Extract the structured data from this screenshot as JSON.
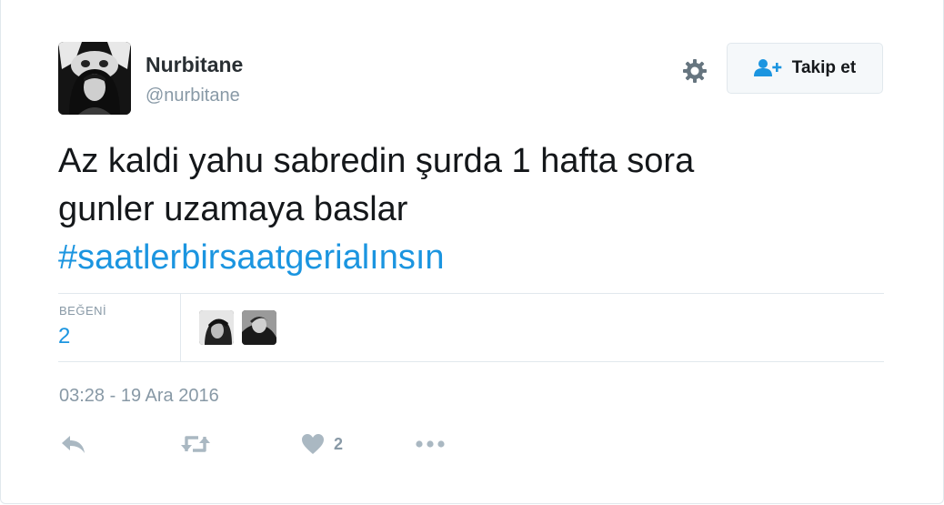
{
  "user": {
    "display_name": "Nurbitane",
    "handle": "@nurbitane"
  },
  "follow_button": {
    "label": "Takip et"
  },
  "tweet": {
    "text_line1": "Az kaldi yahu sabredin şurda 1 hafta sora",
    "text_line2": "gunler uzamaya baslar",
    "hashtag": "#saatlerbirsaatgerialınsın"
  },
  "stats": {
    "likes_label": "BEĞENİ",
    "likes_count": "2"
  },
  "timestamp": "03:28 - 19 Ara 2016",
  "actions": {
    "like_count": "2"
  },
  "colors": {
    "accent": "#1b95e0",
    "muted": "#8899a6",
    "border": "#e1e8ed",
    "icon": "#aab8c2"
  },
  "icons": {
    "settings": "gear-icon",
    "follow": "add-user-icon",
    "reply": "reply-icon",
    "retweet": "retweet-icon",
    "like": "heart-icon",
    "more": "more-icon"
  }
}
